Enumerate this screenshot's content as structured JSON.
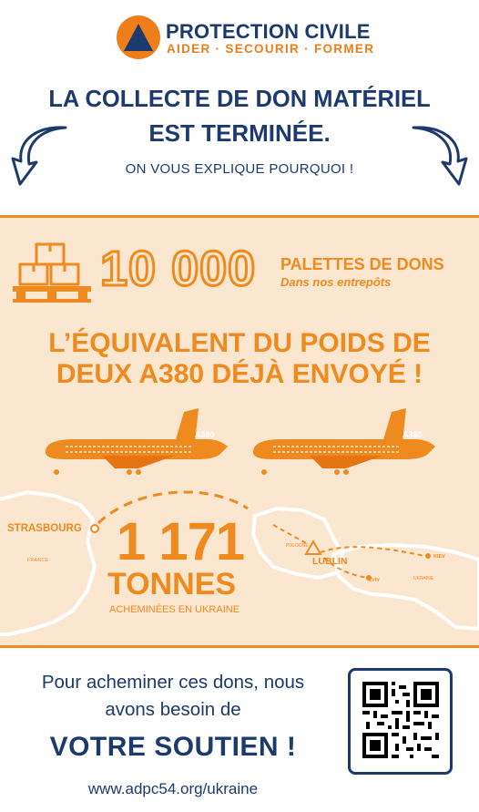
{
  "brand": {
    "name": "PROTECTION CIVILE",
    "tagline": "AIDER · SECOURIR · FORMER",
    "colors": {
      "navy": "#1d3a6e",
      "orange": "#ee7d1a",
      "beige": "#fbe6d0"
    }
  },
  "headline": {
    "line1": "LA COLLECTE DE DON MATÉRIEL",
    "line2": "EST TERMINÉE.",
    "subline": "ON VOUS EXPLIQUE POURQUOI !"
  },
  "pallets": {
    "number": "10 000",
    "label": "PALETTES DE DONS",
    "sub": "Dans nos entrepôts",
    "icon": "boxes-on-pallet-icon"
  },
  "equivalent": {
    "line1": "L’ÉQUIVALENT DU POIDS DE",
    "line2": "DEUX A380 DÉJÀ ENVOYÉ !"
  },
  "planes": [
    {
      "label": "A380"
    },
    {
      "label": "A380"
    }
  ],
  "map": {
    "strasbourg": "STRASBOURG",
    "france": "FRANCE",
    "pologne": "POLOGNE",
    "lublin": "LUBLIN",
    "kiev": "KIEV",
    "lviv": "LVIV",
    "ukraine": "UKRAINE"
  },
  "tonnage": {
    "number": "1 171",
    "unit": "TONNES",
    "caption": "ACHEMINÉES EN UKRAINE"
  },
  "footer": {
    "cta_line1": "Pour acheminer ces dons, nous",
    "cta_line2": "avons besoin de",
    "cta_line3": "VOTRE SOUTIEN !",
    "website": "www.adpc54.org/ukraine",
    "qr_icon": "qr-code-icon"
  }
}
